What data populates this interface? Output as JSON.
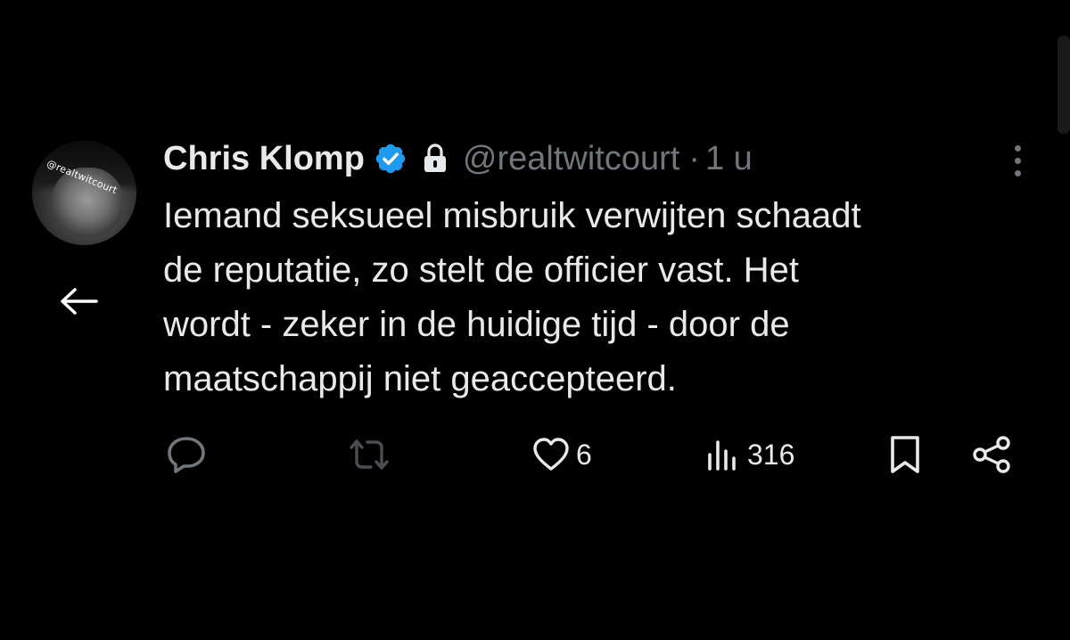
{
  "colors": {
    "background": "#000000",
    "text_primary": "#e7e9ea",
    "text_secondary": "#71767b",
    "verified_badge": "#1d9bf0"
  },
  "navigation": {
    "back_icon": "arrow-left-icon"
  },
  "author": {
    "avatar_watermark": "@realtwitcourt",
    "name": "Chris Klomp",
    "verified_icon": "verified-badge-icon",
    "lock_icon": "lock-icon",
    "handle": "@realtwitcourt",
    "separator": "·",
    "time": "1 u"
  },
  "more_icon": "more-vertical-icon",
  "tweet": {
    "text": "Iemand seksueel misbruik verwijten schaadt\nde reputatie, zo stelt de officier vast. Het\nwordt - zeker in de huidige tijd - door de\nmaatschappij niet geaccepteerd."
  },
  "actions": {
    "reply": {
      "icon": "reply-icon",
      "count": ""
    },
    "repost": {
      "icon": "repost-icon",
      "count": ""
    },
    "like": {
      "icon": "heart-icon",
      "count": "6"
    },
    "views": {
      "icon": "views-icon",
      "count": "316"
    },
    "bookmark": {
      "icon": "bookmark-icon"
    },
    "share": {
      "icon": "share-icon"
    }
  }
}
